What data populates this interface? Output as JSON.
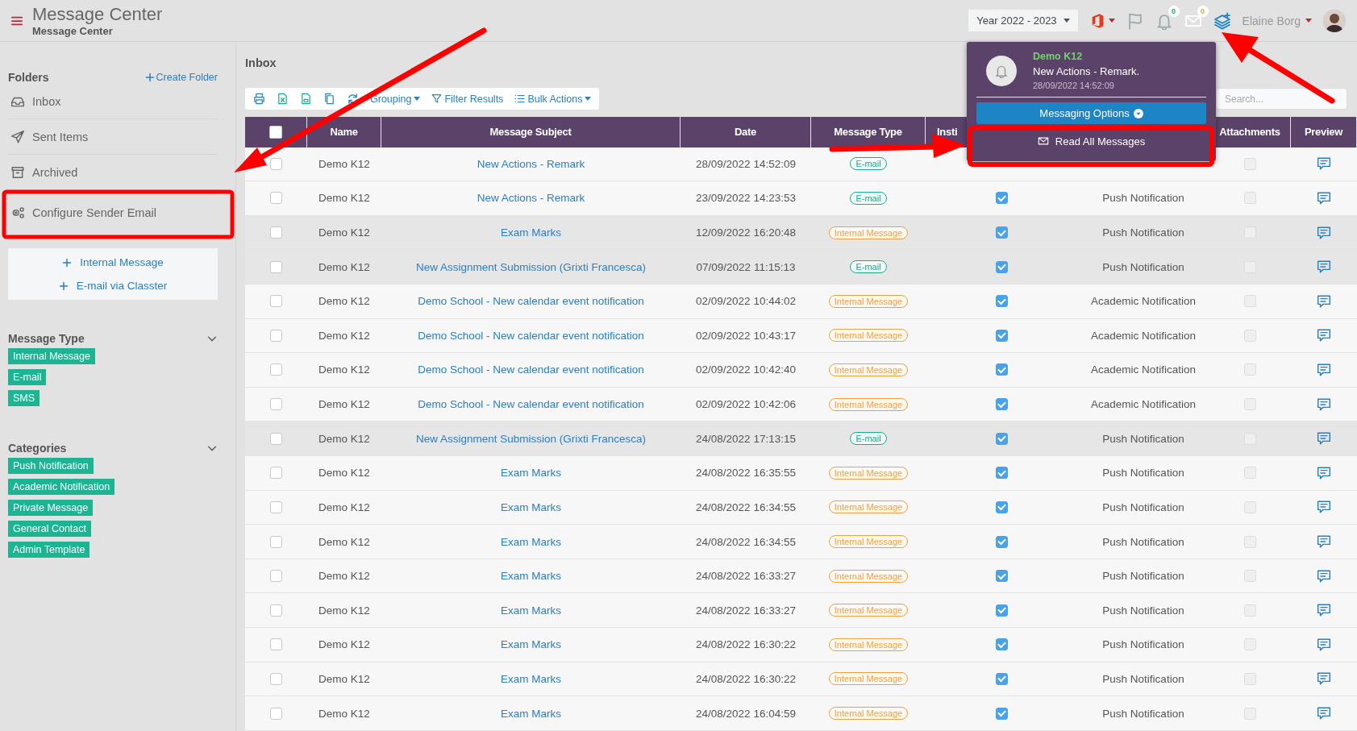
{
  "header": {
    "title": "Message Center",
    "subtitle": "Message Center",
    "year_select": "Year 2022 - 2023",
    "notifications_count": "0",
    "messages_count": "0",
    "user_name": "Elaine Borg"
  },
  "sidebar": {
    "folders_title": "Folders",
    "create_folder": "Create Folder",
    "folders": [
      {
        "kind": "inbox",
        "label": "Inbox"
      },
      {
        "kind": "sent",
        "label": "Sent Items"
      },
      {
        "kind": "archive",
        "label": "Archived"
      },
      {
        "kind": "settings",
        "label": "Configure Sender Email"
      }
    ],
    "compose": [
      "Internal Message",
      "E-mail via Classter"
    ],
    "message_type": {
      "title": "Message Type",
      "tags": [
        "Internal Message",
        "E-mail",
        "SMS"
      ]
    },
    "categories": {
      "title": "Categories",
      "tags": [
        "Push Notification",
        "Academic Notification",
        "Private Message",
        "General Contact",
        "Admin Template"
      ]
    }
  },
  "inbox": {
    "title": "Inbox",
    "toolbar": {
      "grouping": "Grouping",
      "filter": "Filter Results",
      "bulk_actions": "Bulk Actions"
    },
    "search": {
      "placeholder": "Search..."
    },
    "table": {
      "columns": [
        "Name",
        "Message Subject",
        "Date",
        "Message Type",
        "Insti",
        "Attachments",
        "Preview"
      ],
      "header_checkbox_checked": false,
      "rows": [
        {
          "selected": false,
          "highlighted": false,
          "name": "Demo K12",
          "subject": "New Actions - Remark",
          "date": "28/09/2022 14:52:09",
          "type": {
            "kind": "email",
            "label": "E-mail"
          },
          "attachments": false
        },
        {
          "selected": false,
          "highlighted": false,
          "name": "Demo K12",
          "subject": "New Actions - Remark",
          "date": "23/09/2022 14:23:53",
          "type": {
            "kind": "email",
            "label": "E-mail"
          },
          "insti_checked": true,
          "column_6": "Push Notification",
          "attachments": false
        },
        {
          "selected": false,
          "highlighted": true,
          "name": "Demo K12",
          "subject": "Exam Marks",
          "date": "12/09/2022 16:20:48",
          "type": {
            "kind": "internal",
            "label": "Internal Message"
          },
          "insti_checked": true,
          "column_6": "Push Notification",
          "attachments": false
        },
        {
          "selected": false,
          "highlighted": true,
          "name": "Demo K12",
          "subject": "New Assignment Submission (Grixti Francesca)",
          "date": "07/09/2022 11:15:13",
          "type": {
            "kind": "email",
            "label": "E-mail"
          },
          "insti_checked": true,
          "column_6": "Push Notification",
          "attachments": false
        },
        {
          "selected": false,
          "highlighted": false,
          "name": "Demo K12",
          "subject": "Demo School - New calendar event notification",
          "date": "02/09/2022 10:44:02",
          "type": {
            "kind": "internal",
            "label": "Internal Message"
          },
          "insti_checked": true,
          "column_6": "Academic Notification",
          "attachments": false
        },
        {
          "selected": false,
          "highlighted": false,
          "name": "Demo K12",
          "subject": "Demo School - New calendar event notification",
          "date": "02/09/2022 10:43:17",
          "type": {
            "kind": "internal",
            "label": "Internal Message"
          },
          "insti_checked": true,
          "column_6": "Academic Notification",
          "attachments": false
        },
        {
          "selected": false,
          "highlighted": false,
          "name": "Demo K12",
          "subject": "Demo School - New calendar event notification",
          "date": "02/09/2022 10:42:40",
          "type": {
            "kind": "internal",
            "label": "Internal Message"
          },
          "insti_checked": true,
          "column_6": "Academic Notification",
          "attachments": false
        },
        {
          "selected": false,
          "highlighted": false,
          "name": "Demo K12",
          "subject": "Demo School - New calendar event notification",
          "date": "02/09/2022 10:42:06",
          "type": {
            "kind": "internal",
            "label": "Internal Message"
          },
          "insti_checked": true,
          "column_6": "Academic Notification",
          "attachments": false
        },
        {
          "selected": false,
          "highlighted": true,
          "name": "Demo K12",
          "subject": "New Assignment Submission (Grixti Francesca)",
          "date": "24/08/2022 17:13:15",
          "type": {
            "kind": "email",
            "label": "E-mail"
          },
          "insti_checked": true,
          "column_6": "Push Notification",
          "attachments": false
        },
        {
          "selected": false,
          "highlighted": false,
          "name": "Demo K12",
          "subject": "Exam Marks",
          "date": "24/08/2022 16:35:55",
          "type": {
            "kind": "internal",
            "label": "Internal Message"
          },
          "insti_checked": true,
          "column_6": "Push Notification",
          "attachments": false
        },
        {
          "selected": false,
          "highlighted": false,
          "name": "Demo K12",
          "subject": "Exam Marks",
          "date": "24/08/2022 16:34:55",
          "type": {
            "kind": "internal",
            "label": "Internal Message"
          },
          "insti_checked": true,
          "column_6": "Push Notification",
          "attachments": false
        },
        {
          "selected": false,
          "highlighted": false,
          "name": "Demo K12",
          "subject": "Exam Marks",
          "date": "24/08/2022 16:34:55",
          "type": {
            "kind": "internal",
            "label": "Internal Message"
          },
          "insti_checked": true,
          "column_6": "Push Notification",
          "attachments": false
        },
        {
          "selected": false,
          "highlighted": false,
          "name": "Demo K12",
          "subject": "Exam Marks",
          "date": "24/08/2022 16:33:27",
          "type": {
            "kind": "internal",
            "label": "Internal Message"
          },
          "insti_checked": true,
          "column_6": "Push Notification",
          "attachments": false
        },
        {
          "selected": false,
          "highlighted": false,
          "name": "Demo K12",
          "subject": "Exam Marks",
          "date": "24/08/2022 16:33:27",
          "type": {
            "kind": "internal",
            "label": "Internal Message"
          },
          "insti_checked": true,
          "column_6": "Push Notification",
          "attachments": false
        },
        {
          "selected": false,
          "highlighted": false,
          "name": "Demo K12",
          "subject": "Exam Marks",
          "date": "24/08/2022 16:30:22",
          "type": {
            "kind": "internal",
            "label": "Internal Message"
          },
          "insti_checked": true,
          "column_6": "Push Notification",
          "attachments": false
        },
        {
          "selected": false,
          "highlighted": false,
          "name": "Demo K12",
          "subject": "Exam Marks",
          "date": "24/08/2022 16:30:22",
          "type": {
            "kind": "internal",
            "label": "Internal Message"
          },
          "insti_checked": true,
          "column_6": "Push Notification",
          "attachments": false
        },
        {
          "selected": false,
          "highlighted": false,
          "name": "Demo K12",
          "subject": "Exam Marks",
          "date": "24/08/2022 16:04:59",
          "type": {
            "kind": "internal",
            "label": "Internal Message"
          },
          "insti_checked": true,
          "column_6": "Push Notification",
          "attachments": false
        }
      ]
    }
  },
  "notification_popup": {
    "sender": "Demo K12",
    "text": "New Actions - Remark.",
    "time": "28/09/2022 14:52:09",
    "options_button": "Messaging Options",
    "read_all_button": "Read All Messages"
  }
}
